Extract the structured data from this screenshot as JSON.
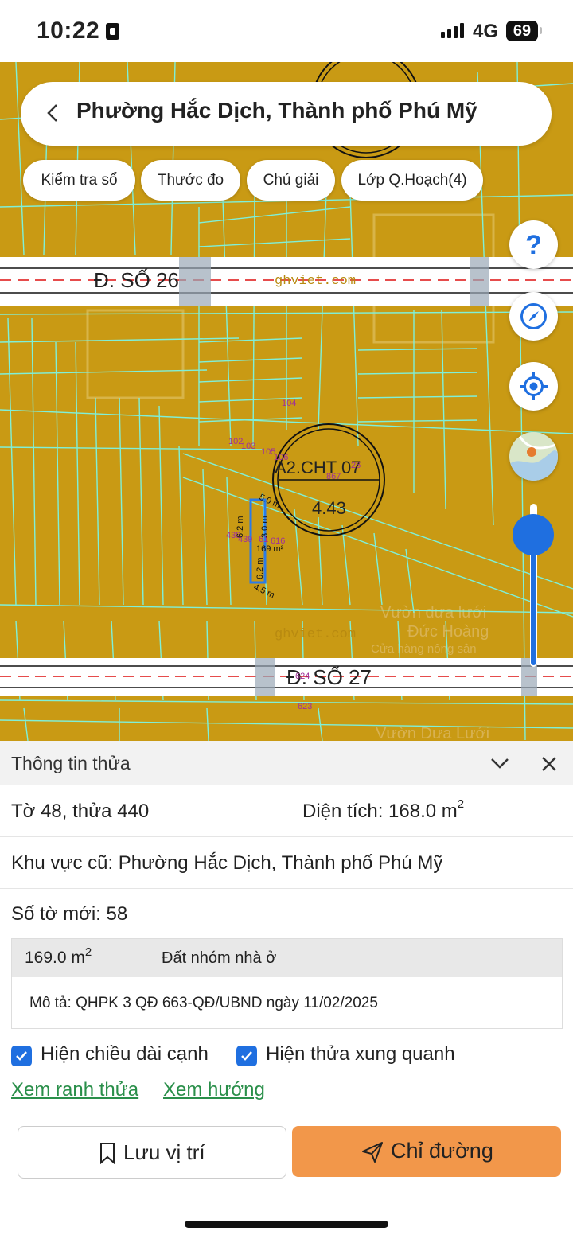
{
  "status_bar": {
    "time": "10:22",
    "network": "4G",
    "battery": "69"
  },
  "map": {
    "search_title": "Phường Hắc Dịch, Thành phố Phú Mỹ",
    "chips": [
      "Kiểm tra sổ",
      "Thước đo",
      "Chú giải",
      "Lớp Q.Hoạch(4)"
    ],
    "help_glyph": "?",
    "road_labels": [
      "Đ. SỐ 26",
      "Đ. SỐ 27"
    ],
    "watermark": "ghviet.com",
    "zone_code": "A2.CHT 07",
    "zone_value": "4.43",
    "parcel_numbers": [
      "104",
      "102",
      "103",
      "105",
      "106",
      "26",
      "867",
      "438",
      "439",
      "61",
      "616",
      "624",
      "623"
    ],
    "parcel_area_label": "169 m²",
    "edge_lengths": [
      "5.0 m",
      "6.2 m",
      "3.0 m",
      "6.2 m",
      "4.5 m"
    ],
    "poi_labels": [
      "Vườn dưa lưới",
      "Đức Hoàng",
      "Cửa hàng nông sản",
      "Vườn Dưa Lưới"
    ],
    "colors": {
      "land": "#c99a14",
      "parcel_lines": "#7ff0d8",
      "road": "#ffffff",
      "accent": "#1f6fe0"
    }
  },
  "panel": {
    "title": "Thông tin thửa",
    "sheet_parcel": "Tờ 48, thửa 440",
    "area_label": "Diện tích: 168.0 m",
    "area_sup": "2",
    "old_area": "Khu vực cũ: Phường Hắc Dịch, Thành phố Phú Mỹ",
    "new_sheet": "Số tờ mới: 58",
    "zone": {
      "area": "169.0 m",
      "area_sup": "2",
      "type": "Đất nhóm nhà ở",
      "description": "Mô tả: QHPK 3 QĐ 663-QĐ/UBND ngày 11/02/2025"
    },
    "checkbox_edges": "Hiện chiều dài cạnh",
    "checkbox_neighbors": "Hiện thửa xung quanh",
    "link_boundary": "Xem ranh thửa",
    "link_direction": "Xem hướng",
    "save_label": "Lưu vị trí",
    "directions_label": "Chỉ đường",
    "colors": {
      "directions_button": "#f2974a",
      "link": "#2a8f4a"
    }
  }
}
